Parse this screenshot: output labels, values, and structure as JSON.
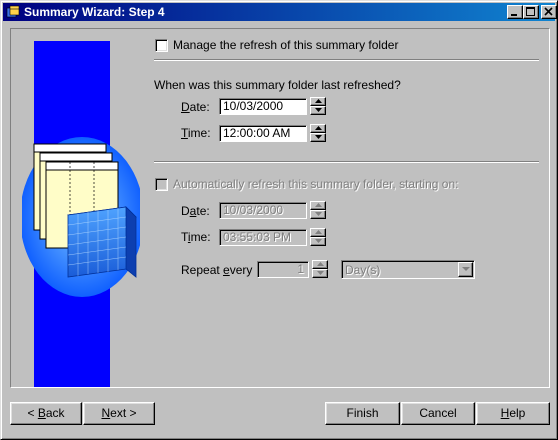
{
  "window": {
    "title": "Summary Wizard: Step 4"
  },
  "manage": {
    "checkbox_label": "Manage the refresh of this summary folder",
    "checked": false
  },
  "last_refreshed": {
    "question": "When was this summary folder last refreshed?",
    "date_label": "Date:",
    "date_value": "10/03/2000",
    "time_label": "Time:",
    "time_value": "12:00:00 AM"
  },
  "auto_refresh": {
    "checkbox_label": "Automatically refresh this summary folder, starting on:",
    "checked": false,
    "enabled": false,
    "date_label": "Date:",
    "date_value": "10/03/2000",
    "time_label": "Time:",
    "time_value": "03:55:03 PM",
    "repeat_label": "Repeat every",
    "repeat_value": "1",
    "unit_value": "Day(s)"
  },
  "buttons": {
    "back": "< Back",
    "next": "Next >",
    "finish": "Finish",
    "cancel": "Cancel",
    "help": "Help"
  },
  "colors": {
    "title_bar": "#000080",
    "side_panel": "#0000ff",
    "face": "#c0c0c0"
  },
  "icons": {
    "title": "wizard-app-icon",
    "illustration": "database-cube-illustration"
  }
}
